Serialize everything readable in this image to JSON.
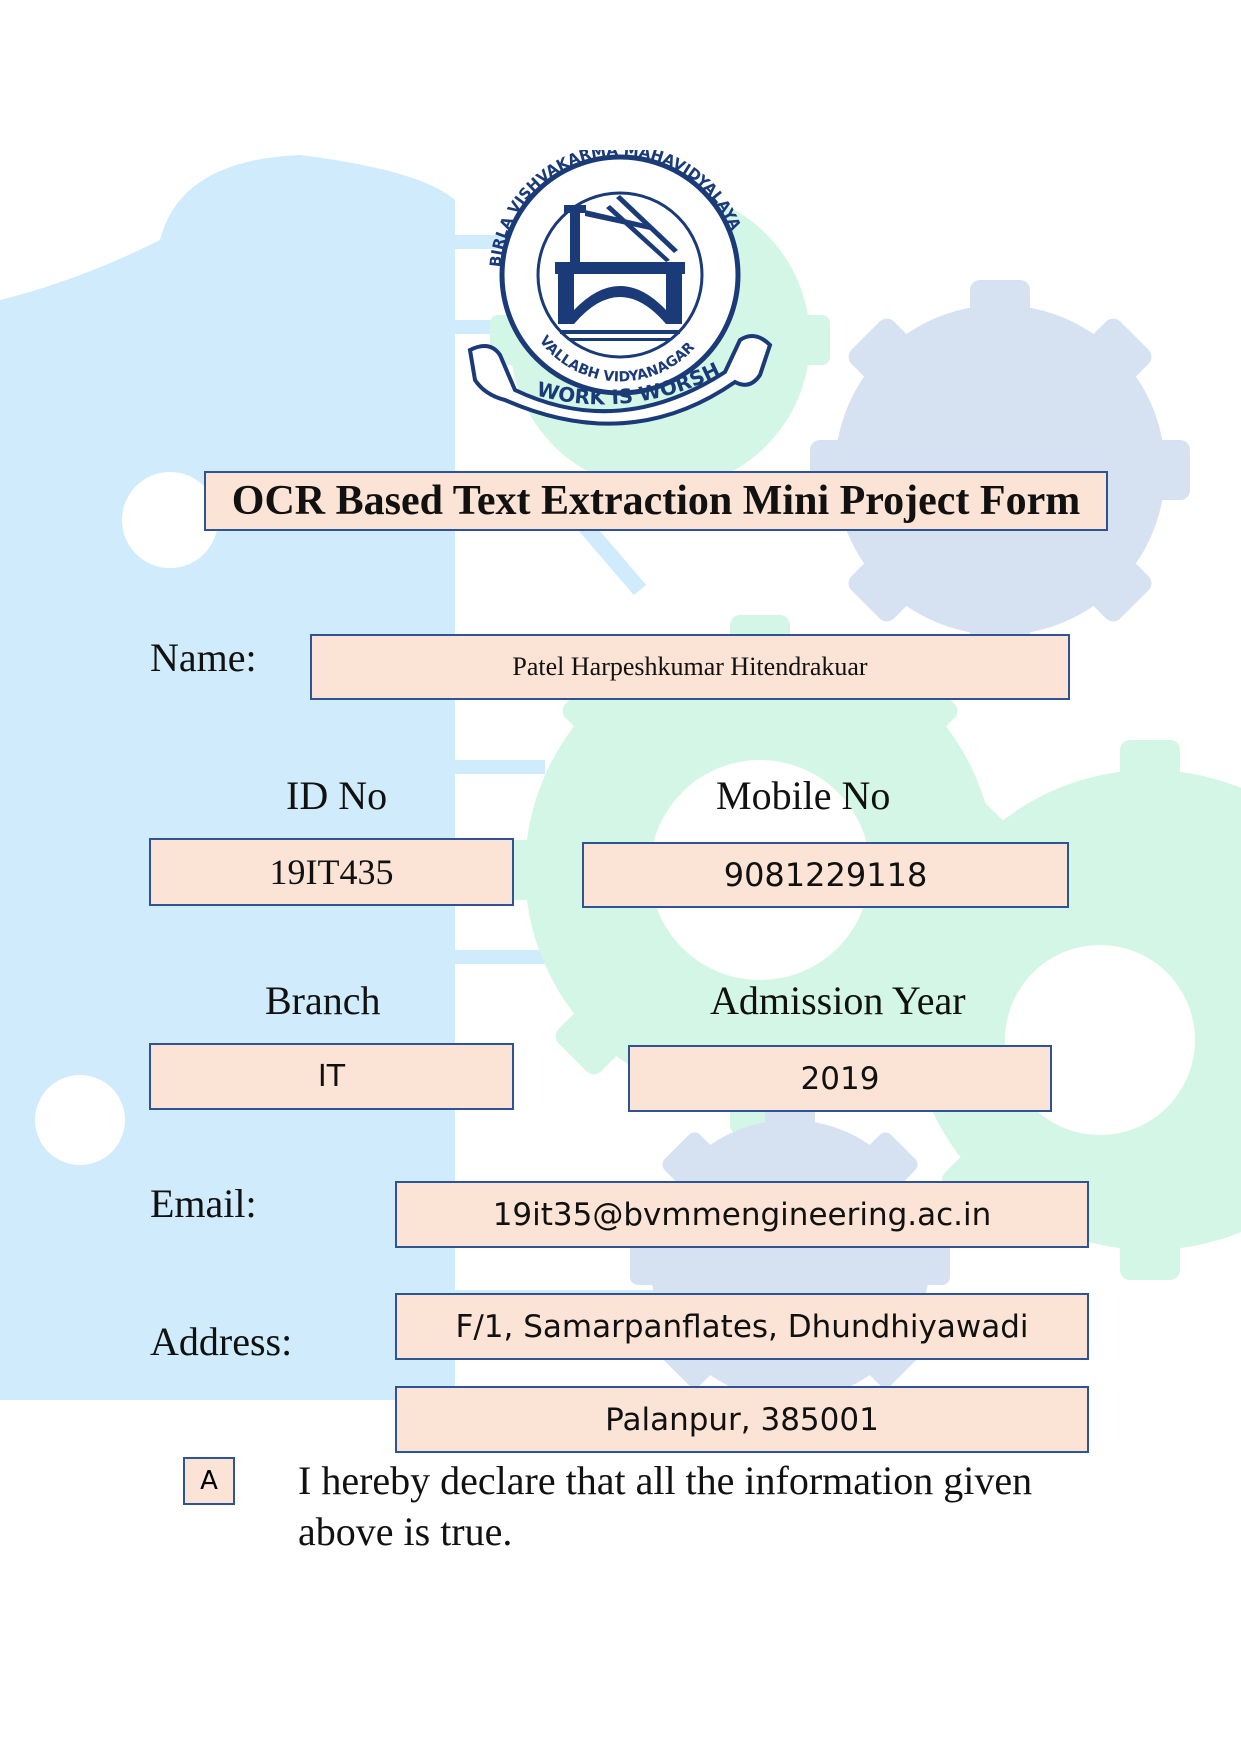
{
  "logo": {
    "ring_text": "BIRLA VISHVAKARMA MAHAVIDYALAYA",
    "ring_bottom_text": "VALLABH VIDYANAGAR",
    "motto": "WORK IS WORSHIP",
    "colors": {
      "navy": "#1a3a78"
    }
  },
  "form": {
    "title": "OCR Based Text Extraction Mini Project Form",
    "name_label": "Name:",
    "name_value": "Patel Harpeshkumar Hitendrakuar",
    "id_label": "ID No",
    "id_value": "19IT435",
    "mobile_label": "Mobile No",
    "mobile_value": "9081229118",
    "branch_label": "Branch",
    "branch_value": "IT",
    "year_label": "Admission Year",
    "year_value": "2019",
    "email_label": "Email:",
    "email_value": "19it35@bvmmengineering.ac.in",
    "address_label": "Address:",
    "address_line1": "F/1, Samarpanflates, Dhundhiyawadi",
    "address_line2": "Palanpur, 385001",
    "checkbox_mark": "A",
    "declaration": "I hereby declare that all the information given above is true."
  },
  "colors": {
    "field_fill": "#fbe4d5",
    "field_border": "#2f5496",
    "bg_blue": "#d0ebfb",
    "bg_green": "#d4f6e6",
    "bg_gear": "#d6e2f2"
  }
}
